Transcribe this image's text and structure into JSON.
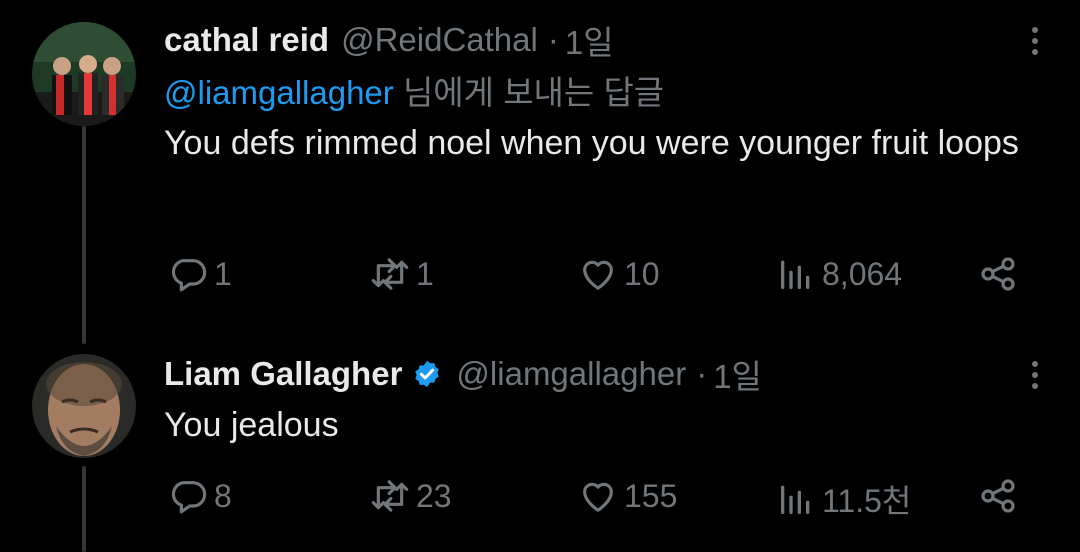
{
  "tweets": [
    {
      "name": "cathal reid",
      "handle": "@ReidCathal",
      "separator": "·",
      "time": "1일",
      "reply_to_mention": "@liamgallagher",
      "reply_to_suffix": " 님에게 보내는 답글",
      "text": "You defs rimmed noel when you were younger fruit loops",
      "verified": false,
      "stats": {
        "replies": "1",
        "retweets": "1",
        "likes": "10",
        "views": "8,064"
      }
    },
    {
      "name": "Liam Gallagher",
      "handle": "@liamgallagher",
      "separator": "·",
      "time": "1일",
      "text": "You jealous",
      "verified": true,
      "stats": {
        "replies": "8",
        "retweets": "23",
        "likes": "155",
        "views": "11.5천"
      }
    }
  ],
  "colors": {
    "background": "#000000",
    "text": "#e7e9ea",
    "muted": "#71767b",
    "link": "#1d9bf0",
    "verified": "#1d9bf0"
  },
  "icons": [
    "reply-icon",
    "retweet-icon",
    "like-icon",
    "views-icon",
    "share-icon",
    "more-icon",
    "verified-badge-icon"
  ]
}
